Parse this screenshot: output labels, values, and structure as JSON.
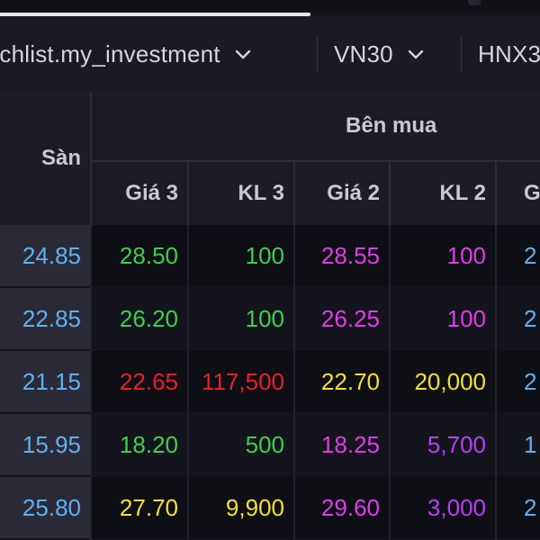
{
  "tabs": [
    {
      "label": "tchlist.my_investment"
    },
    {
      "label": "VN30"
    },
    {
      "label": "HNX3"
    }
  ],
  "header": {
    "san": "Sàn",
    "ben_mua": "Bên mua",
    "cols": [
      "Giá 3",
      "KL 3",
      "Giá 2",
      "KL 2",
      "G"
    ]
  },
  "rows": [
    {
      "san": "24.85",
      "gia3": "28.50",
      "kl3": "100",
      "gia2": "28.55",
      "kl2": "100",
      "g1": "2"
    },
    {
      "san": "22.85",
      "gia3": "26.20",
      "kl3": "100",
      "gia2": "26.25",
      "kl2": "100",
      "g1": "2"
    },
    {
      "san": "21.15",
      "gia3": "22.65",
      "kl3": "117,500",
      "gia2": "22.70",
      "kl2": "20,000",
      "g1": "2"
    },
    {
      "san": "15.95",
      "gia3": "18.20",
      "kl3": "500",
      "gia2": "18.25",
      "kl2": "5,700",
      "g1": "1"
    },
    {
      "san": "25.80",
      "gia3": "27.70",
      "kl3": "9,900",
      "gia2": "29.60",
      "kl2": "3,000",
      "g1": "2"
    }
  ],
  "colors": {
    "up": "#3fd04a",
    "ceiling": "#e03ce8",
    "down": "#e8202a",
    "reference": "#f3e32a",
    "floor": "#5fb0f0",
    "volume_purple": "#b542f0"
  },
  "icons": [
    "chevron-down-icon"
  ]
}
